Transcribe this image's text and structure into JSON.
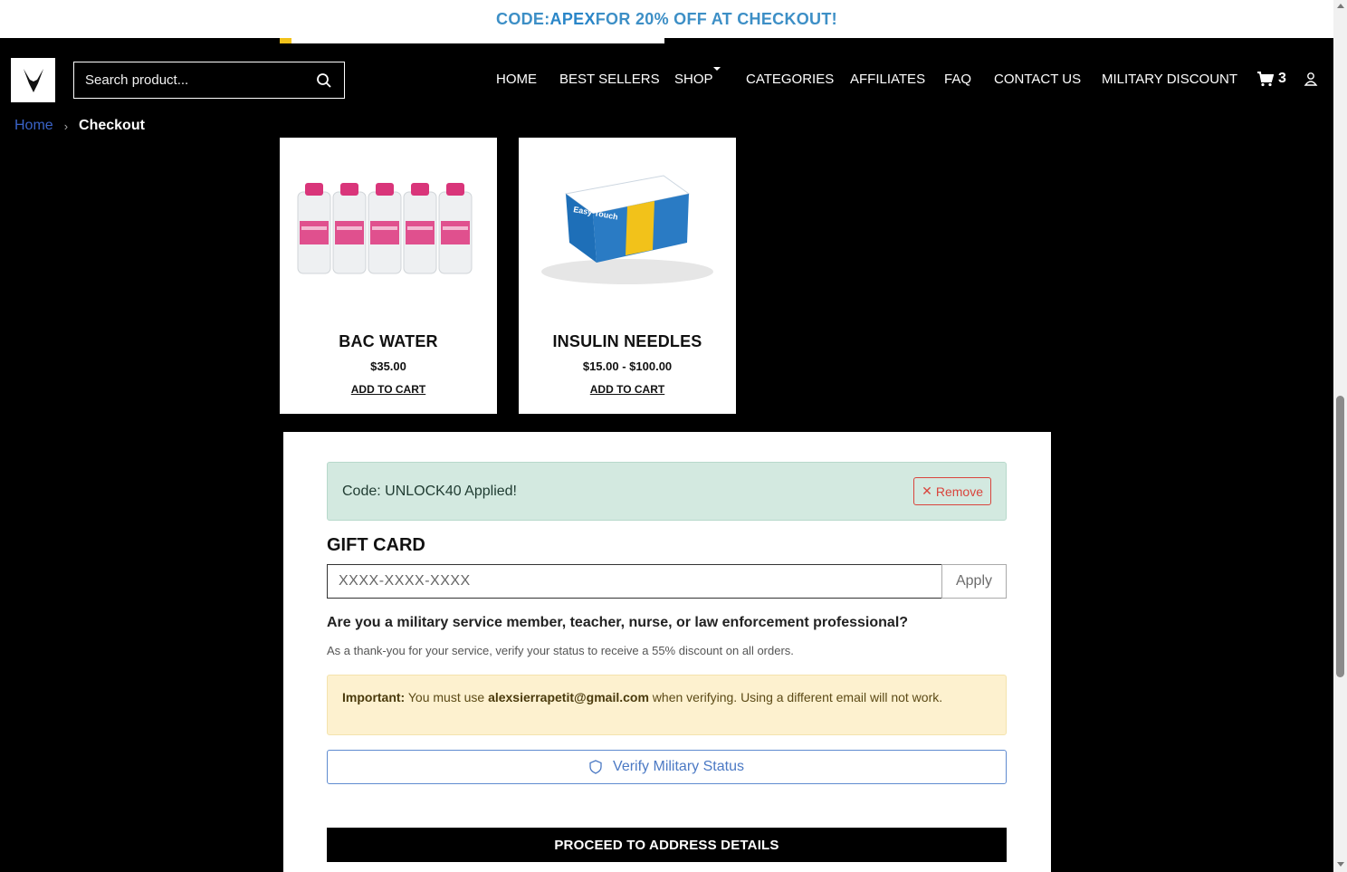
{
  "announcement": {
    "prefix": "CODE: ",
    "code": "APEX",
    "suffix": " FOR 20% OFF AT CHECKOUT!"
  },
  "header": {
    "logo_icon": "horns-logo-icon",
    "search": {
      "placeholder": "Search product..."
    },
    "nav": [
      "HOME",
      "BEST SELLERS",
      "SHOP",
      "CATEGORIES",
      "AFFILIATES",
      "FAQ",
      "CONTACT US",
      "MILITARY DISCOUNT"
    ],
    "cart_count": "3"
  },
  "breadcrumb": {
    "home": "Home",
    "separator": "›",
    "current": "Checkout"
  },
  "products": [
    {
      "name": "BAC WATER",
      "price": "$35.00",
      "cta": "ADD TO CART"
    },
    {
      "name": "INSULIN NEEDLES",
      "price": "$15.00 - $100.00",
      "cta": "ADD TO CART"
    }
  ],
  "checkout": {
    "applied_text": "Code: UNLOCK40 Applied!",
    "remove_label": "Remove",
    "gift_title": "GIFT CARD",
    "gift_placeholder": "XXXX-XXXX-XXXX",
    "apply_label": "Apply",
    "military_question": "Are you a military service member, teacher, nurse, or law enforcement professional?",
    "military_sub": "As a thank-you for your service, verify your status to receive a 55% discount on all orders.",
    "notice_label": "Important:",
    "notice_pre": " You must use ",
    "notice_email": "alexsierrapetit@gmail.com",
    "notice_post": " when verifying. Using a different email will not work.",
    "verify_label": "Verify Military Status",
    "proceed_label": "PROCEED TO ADDRESS DETAILS"
  },
  "colors": {
    "accent_blue": "#3d8fc6",
    "success_bg": "#d3e9e0",
    "warning_bg": "#fdf1cf",
    "danger": "#d9443c"
  }
}
